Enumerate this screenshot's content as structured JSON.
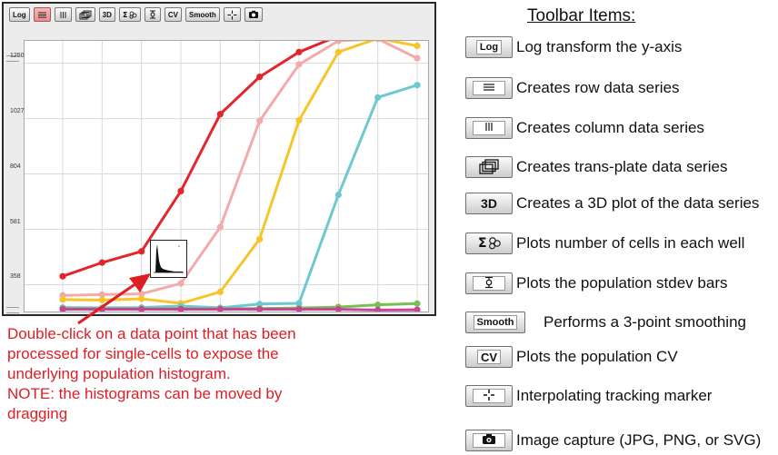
{
  "toolbar": {
    "buttons": [
      {
        "label": "Log",
        "icon": ""
      },
      {
        "label": "",
        "icon": "row-series-icon"
      },
      {
        "label": "",
        "icon": "column-series-icon"
      },
      {
        "label": "",
        "icon": "trans-plate-icon"
      },
      {
        "label": "3D",
        "icon": ""
      },
      {
        "label": "",
        "icon": "cell-count-icon"
      },
      {
        "label": "",
        "icon": "stdev-bars-icon"
      },
      {
        "label": "CV",
        "icon": ""
      },
      {
        "label": "Smooth",
        "icon": ""
      },
      {
        "label": "",
        "icon": "tracking-marker-icon"
      },
      {
        "label": "",
        "icon": "camera-icon"
      }
    ],
    "active_index": 1
  },
  "chart_data": {
    "type": "line",
    "title": "",
    "xlabel": "",
    "ylabel": "",
    "y_tick_labels": [
      "358",
      "581",
      "804",
      "1027",
      "1250"
    ],
    "ylim": [
      250,
      1340
    ],
    "x": [
      1,
      2,
      3,
      4,
      5,
      6,
      7,
      8,
      9,
      10
    ],
    "grid": true,
    "series": [
      {
        "color": "#e3262b",
        "values": [
          392,
          447,
          492,
          735,
          1045,
          1195,
          1295,
          1360,
          1360,
          1360
        ]
      },
      {
        "color": "#f3aaab",
        "values": [
          315,
          318,
          321,
          363,
          590,
          1018,
          1245,
          1340,
          1348,
          1270
        ]
      },
      {
        "color": "#f7c52a",
        "values": [
          298,
          296,
          301,
          283,
          329,
          542,
          1020,
          1295,
          1350,
          1320
        ]
      },
      {
        "color": "#6cc9d1",
        "values": [
          266,
          265,
          266,
          272,
          265,
          280,
          283,
          720,
          1112,
          1162
        ]
      },
      {
        "color": "#77c24f",
        "values": [
          262,
          261,
          261,
          262,
          261,
          262,
          264,
          268,
          277,
          282
        ]
      },
      {
        "color": "#c8449a",
        "values": [
          259,
          259,
          259,
          259,
          259,
          259,
          259,
          259,
          256,
          257
        ]
      }
    ]
  },
  "annotation": {
    "lines": [
      "Double-click on a data point that has been",
      "processed for single-cells to expose the",
      "underlying population histogram.",
      "NOTE: the histograms can be moved by",
      "dragging"
    ]
  },
  "legend": {
    "title": "Toolbar Items:",
    "items": [
      {
        "label": "Log",
        "icon": "",
        "text": "Log transform the y-axis"
      },
      {
        "label": "",
        "icon": "row-series-icon",
        "text": "Creates row data series"
      },
      {
        "label": "",
        "icon": "column-series-icon",
        "text": "Creates column data series"
      },
      {
        "label": "",
        "icon": "trans-plate-icon",
        "text": "Creates trans-plate data series"
      },
      {
        "label": "3D",
        "icon": "",
        "text": "Creates a 3D plot of the data series"
      },
      {
        "label": "",
        "icon": "cell-count-icon",
        "text": "Plots number of cells in each well"
      },
      {
        "label": "",
        "icon": "stdev-bars-icon",
        "text": "Plots the population stdev bars"
      },
      {
        "label": "Smooth",
        "icon": "",
        "text": "Performs a 3-point smoothing"
      },
      {
        "label": "CV",
        "icon": "",
        "text": "Plots the population CV"
      },
      {
        "label": "",
        "icon": "tracking-marker-icon",
        "text": "Interpolating tracking marker"
      },
      {
        "label": "",
        "icon": "camera-icon",
        "text": "Image capture (JPG, PNG, or SVG)"
      }
    ]
  },
  "colors": {
    "annotation": "#dd1e25",
    "active_button": "#e58f8f"
  }
}
